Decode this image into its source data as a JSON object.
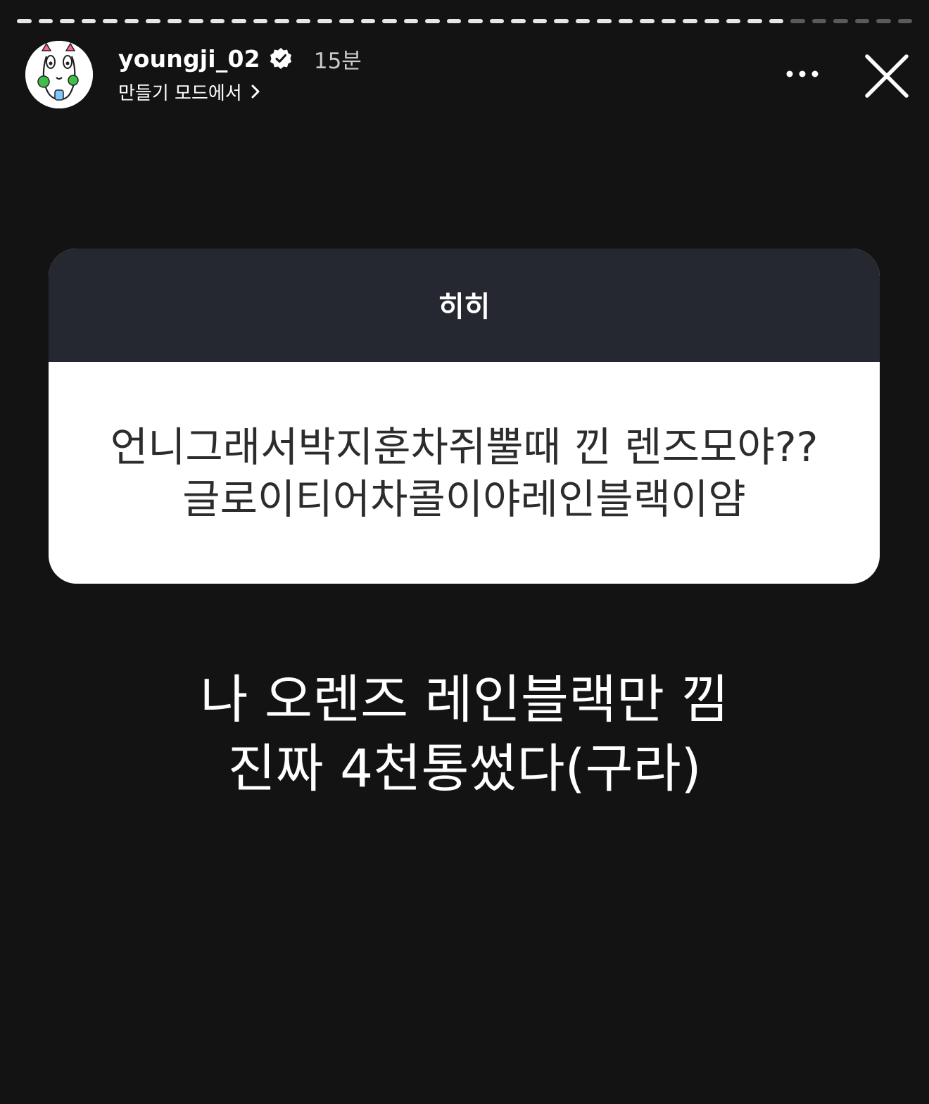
{
  "progress": {
    "segments_total": 42,
    "segments_viewed": 36
  },
  "header": {
    "username": "youngji_02",
    "verified_icon": "verified-badge-icon",
    "time_ago": "15분",
    "subtitle": "만들기 모드에서",
    "more_icon": "more-options-icon",
    "close_icon": "close-icon"
  },
  "sticker": {
    "question": "히히",
    "answer_lines": [
      "언니그래서박지훈차쥐뿔때 낀 렌즈모야??",
      "글로이티어차콜이야레인블랙이얌"
    ]
  },
  "caption": {
    "lines": [
      "나 오렌즈 레인블랙만 낌",
      "진짜 4천통썼다(구라)"
    ]
  },
  "colors": {
    "background": "#131313",
    "sticker_header": "#252830",
    "sticker_body": "#ffffff",
    "progress_viewed": "#e6e6e6",
    "progress_remaining": "#5a5a5a"
  }
}
